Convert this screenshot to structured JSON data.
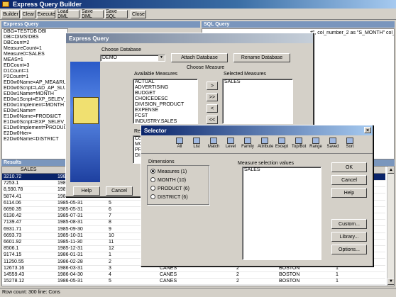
{
  "app": {
    "title": "Express Query Builder"
  },
  "toolbar": {
    "buttons": [
      "Builder",
      "Clear",
      "Execute",
      "Load DML",
      "Save DML",
      "Save SQL",
      "Close"
    ]
  },
  "query_panel": {
    "title": "Express Query",
    "lines": [
      "DBG=TESTDB DBI",
      "DBI=DIMS!DBS",
      "DBCount=2",
      "MeasureCount=1",
      "Measure0=SALES",
      "MEAS=1",
      "EDCount=3",
      "D1Count=1",
      "P2Count=1",
      "ED0w0Name=AP_MEA&RUBIK",
      "ED0w0Script=LAD_AP_SLUMMR",
      "ED0w1Name=MONTH",
      "ED0w1Script=EXP_SELEV_MARK",
      "ED0w1Implement=MONTH",
      "ED0w1Name=",
      "E1Dw0Name=FROD&ICT",
      "E1Dw0Script=EXP_SELEV_AREA",
      "E1Dw0Implement=PRODUCT",
      "E2Dw0Hier=",
      "E2Dw0Name=DISTRICT"
    ]
  },
  "sql_panel": {
    "title": "SQL Query",
    "text": "#\", col_number_2 as \"S_MONTH\" col_ye"
  },
  "results": {
    "title": "Results",
    "header": "SALES",
    "rows": [
      [
        "3210.72",
        "1985-",
        "",
        "",
        "",
        "",
        ""
      ],
      [
        "7253.1",
        "1985-",
        "",
        "",
        "",
        "",
        ""
      ],
      [
        "8,590.78",
        "1985-",
        "",
        "",
        "",
        "",
        ""
      ],
      [
        "5874.41",
        "1985-",
        "",
        "",
        "",
        "",
        ""
      ],
      [
        "6114.06",
        "1985-05-31",
        "5",
        "",
        "",
        "",
        ""
      ],
      [
        "6690.35",
        "1985-05-31",
        "6",
        "",
        "",
        "",
        ""
      ],
      [
        "6130.42",
        "1985-07-31",
        "7",
        "",
        "",
        "",
        ""
      ],
      [
        "7139.47",
        "1985-08-31",
        "8",
        "",
        "",
        "",
        ""
      ],
      [
        "6931.71",
        "1985-09-30",
        "9",
        "",
        "",
        "",
        ""
      ],
      [
        "6693.73",
        "1985-10-31",
        "10",
        "",
        "",
        "",
        ""
      ],
      [
        "6601.92",
        "1985-11-30",
        "11",
        "",
        "",
        "",
        ""
      ],
      [
        "8506.1",
        "1985-12-31",
        "12",
        "",
        "",
        "",
        ""
      ],
      [
        "9174.15",
        "1986-01-31",
        "1",
        "",
        "",
        "",
        ""
      ],
      [
        "11250.55",
        "1986-02-28",
        "2",
        "",
        "",
        "",
        ""
      ],
      [
        "12673.16",
        "1986-03-31",
        "3",
        "CANES",
        "2",
        "BOSTON",
        "1"
      ],
      [
        "14559.43",
        "1986-04-30",
        "4",
        "CANES",
        "2",
        "BOSTON",
        "1"
      ],
      [
        "15278.12",
        "1986-05-31",
        "5",
        "CANES",
        "2",
        "BOSTON",
        "1"
      ]
    ]
  },
  "status": {
    "text": "Row count: 300  line: Cons"
  },
  "express_dialog": {
    "title": "Express Query",
    "choose_database_label": "Choose Database",
    "database_value": "DEMO",
    "attach_button": "Attach Database",
    "rename_button": "Rename Database",
    "choose_measure_label": "Choose Measure",
    "available_label": "Available Measures",
    "available": [
      "ACTUAL",
      "ADVERTISING",
      "BUDGET",
      "CHOICEDESC",
      "DIVISION_PRODUCT",
      "EXPENSE",
      "FCST",
      "INDUSTRY.SALES"
    ],
    "selected_label": "Selected Measures",
    "selected": [
      "SALES"
    ],
    "report_columns_label": "Report Columns",
    "columns_label": "Columns",
    "columns": [
      "MONTH",
      "PRODUCT",
      "DISTRICT"
    ],
    "help_button": "Help",
    "cancel_button": "Cancel"
  },
  "selector": {
    "title": "Selector",
    "tools": [
      "All",
      "List",
      "Match",
      "Level",
      "Family",
      "Attribute",
      "Except",
      "Top/Bot",
      "Range",
      "Saved",
      "Sort"
    ],
    "dimensions_label": "Dimensions",
    "dimensions": [
      "Measures (1)",
      "MONTH (10)",
      "PRODUCT (6)",
      "DISTRICT (6)"
    ],
    "selected_dimension": 0,
    "values_label": "Measure selection values",
    "values": [
      "SALES"
    ],
    "ok_button": "OK",
    "cancel_button": "Cancel",
    "help_button": "Help",
    "custom_button": "Custom...",
    "library_button": "Library...",
    "options_button": "Options..."
  },
  "colors": {
    "title_active": "#0a246a",
    "title_gradient_end": "#a6caf0",
    "selection": "#0a246a",
    "dialog_bg": "#d4d0c8"
  }
}
